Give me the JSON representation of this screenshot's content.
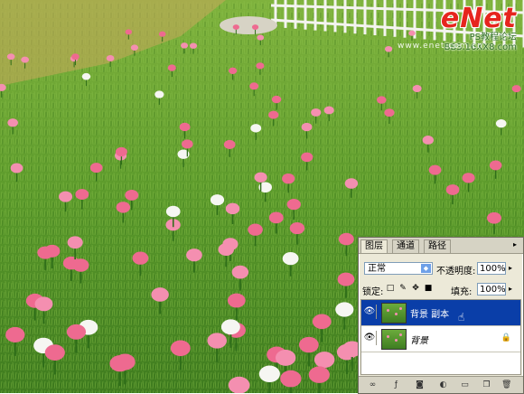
{
  "watermark": {
    "logo": "eNet",
    "subtitle": "PS教程论坛",
    "url": "BBS.16XX8.com",
    "site": "www.enet.com.cn"
  },
  "layers_panel": {
    "tabs": [
      {
        "label": "图层",
        "active": true
      },
      {
        "label": "通道",
        "active": false
      },
      {
        "label": "路径",
        "active": false
      }
    ],
    "blend_mode": "正常",
    "opacity_label": "不透明度:",
    "opacity_value": "100%",
    "lock_label": "锁定:",
    "fill_label": "填充:",
    "fill_value": "100%",
    "layers": [
      {
        "name": "背景 副本",
        "selected": true,
        "visible": true,
        "locked": false
      },
      {
        "name": "背景",
        "selected": false,
        "visible": true,
        "locked": true
      }
    ],
    "icons": {
      "lock_icons": [
        "lock-transparent-icon",
        "lock-brush-icon",
        "lock-move-icon",
        "lock-all-icon"
      ],
      "bottom": [
        "link-layers-icon",
        "layer-style-icon",
        "layer-mask-icon",
        "adjustment-layer-icon",
        "new-group-icon",
        "new-layer-icon",
        "delete-layer-icon"
      ]
    }
  },
  "colors": {
    "selected_layer": "#0a3ea8",
    "panel_bg": "#ece9d8",
    "grass": "#4e8f27",
    "tulip": "#ee6a90"
  }
}
